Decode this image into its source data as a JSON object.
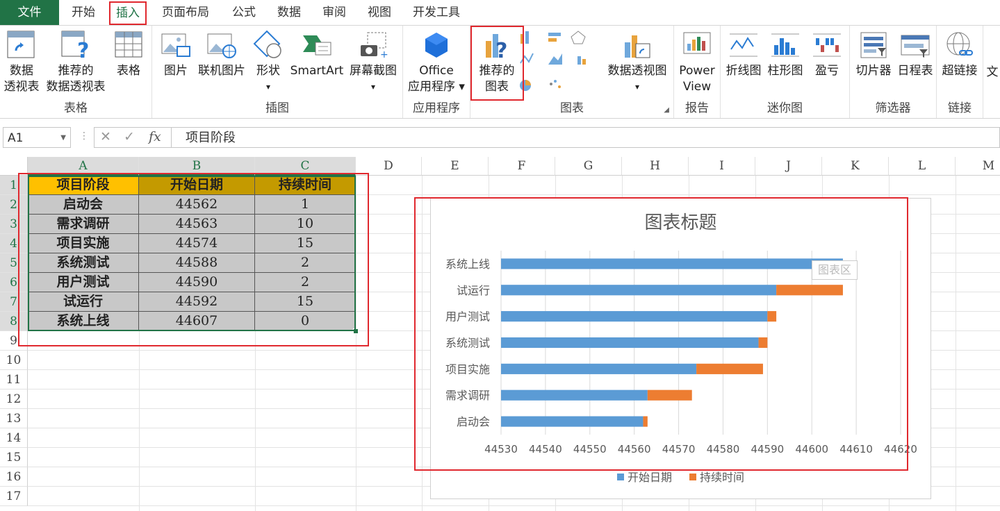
{
  "ribbon_tabs": [
    "文件",
    "开始",
    "插入",
    "页面布局",
    "公式",
    "数据",
    "审阅",
    "视图",
    "开发工具"
  ],
  "ribbon": {
    "groups": [
      {
        "label": "表格",
        "buttons": [
          {
            "label1": "数据",
            "label2": "透视表"
          },
          {
            "label1": "推荐的",
            "label2": "数据透视表"
          },
          {
            "label1": "表格",
            "label2": ""
          }
        ]
      },
      {
        "label": "插图",
        "buttons": [
          {
            "label1": "图片",
            "label2": ""
          },
          {
            "label1": "联机图片",
            "label2": ""
          },
          {
            "label1": "形状",
            "label2": "▾"
          },
          {
            "label1": "SmartArt",
            "label2": ""
          },
          {
            "label1": "屏幕截图",
            "label2": "▾"
          }
        ]
      },
      {
        "label": "应用程序",
        "buttons": [
          {
            "label1": "Office",
            "label2": "应用程序 ▾"
          }
        ]
      },
      {
        "label": "图表",
        "buttons": [
          {
            "label1": "推荐的",
            "label2": "图表"
          },
          {
            "label1": "数据透视图",
            "label2": "▾"
          }
        ]
      },
      {
        "label": "报告",
        "buttons": [
          {
            "label1": "Power",
            "label2": "View"
          }
        ]
      },
      {
        "label": "迷你图",
        "buttons": [
          {
            "label1": "折线图",
            "label2": ""
          },
          {
            "label1": "柱形图",
            "label2": ""
          },
          {
            "label1": "盈亏",
            "label2": ""
          }
        ]
      },
      {
        "label": "筛选器",
        "buttons": [
          {
            "label1": "切片器",
            "label2": ""
          },
          {
            "label1": "日程表",
            "label2": ""
          }
        ]
      },
      {
        "label": "链接",
        "buttons": [
          {
            "label1": "超链接",
            "label2": ""
          }
        ]
      },
      {
        "label": "",
        "buttons": [
          {
            "label1": "文",
            "label2": ""
          }
        ]
      }
    ]
  },
  "formula_bar": {
    "name_box": "A1",
    "content": "项目阶段",
    "fx": "fx"
  },
  "columns": [
    "A",
    "B",
    "C",
    "D",
    "E",
    "F",
    "G",
    "H",
    "I",
    "J",
    "K",
    "L",
    "M"
  ],
  "rows": [
    "1",
    "2",
    "3",
    "4",
    "5",
    "6",
    "7",
    "8",
    "9",
    "10",
    "11",
    "12",
    "13",
    "14",
    "15",
    "16",
    "17"
  ],
  "table": {
    "headers": [
      "项目阶段",
      "开始日期",
      "持续时间"
    ],
    "rows": [
      [
        "启动会",
        "44562",
        "1"
      ],
      [
        "需求调研",
        "44563",
        "10"
      ],
      [
        "项目实施",
        "44574",
        "15"
      ],
      [
        "系统测试",
        "44588",
        "2"
      ],
      [
        "用户测试",
        "44590",
        "2"
      ],
      [
        "试运行",
        "44592",
        "15"
      ],
      [
        "系统上线",
        "44607",
        "0"
      ]
    ]
  },
  "chart_tooltip": "图表区",
  "chart_data": {
    "type": "bar",
    "stacked": true,
    "orientation": "horizontal",
    "title": "图表标题",
    "categories": [
      "启动会",
      "需求调研",
      "项目实施",
      "系统测试",
      "用户测试",
      "试运行",
      "系统上线"
    ],
    "series": [
      {
        "name": "开始日期",
        "values": [
          44562,
          44563,
          44574,
          44588,
          44590,
          44592,
          44607
        ],
        "color": "#5b9bd5"
      },
      {
        "name": "持续时间",
        "values": [
          1,
          10,
          15,
          2,
          2,
          15,
          0
        ],
        "color": "#ed7d31"
      }
    ],
    "xlim": [
      44530,
      44620
    ],
    "xticks": [
      44530,
      44540,
      44550,
      44560,
      44570,
      44580,
      44590,
      44600,
      44610,
      44620
    ],
    "grid": true,
    "legend": "bottom"
  }
}
